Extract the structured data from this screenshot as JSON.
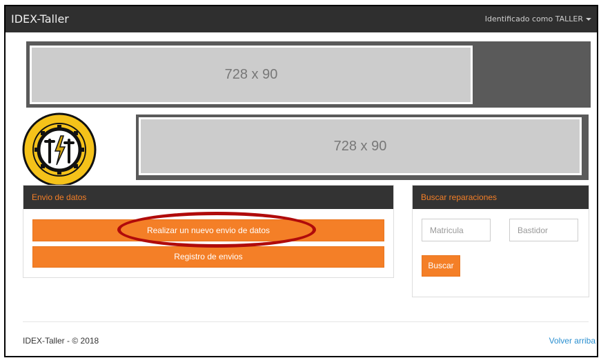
{
  "navbar": {
    "brand": "IDEX-Taller",
    "user_label": "Identificado como TALLER"
  },
  "banners": {
    "top_ad_label": "728 x 90",
    "second_ad_label": "728 x 90"
  },
  "logo": {
    "alt": "Gremi Provincial de Tallers de Reparació d'Automòbils Barcelona"
  },
  "envio_panel": {
    "title": "Envio de datos",
    "new_button_label": "Realizar un nuevo envio de datos",
    "registry_button_label": "Registro de envios"
  },
  "search_panel": {
    "title": "Buscar reparaciones",
    "matricula_placeholder": "Matricula",
    "bastidor_placeholder": "Bastidor",
    "search_button_label": "Buscar"
  },
  "footer": {
    "copyright": "IDEX-Taller - © 2018",
    "back_to_top": "Volver arriba"
  },
  "colors": {
    "navbar_bg": "#2f2f2f",
    "accent_orange": "#f47f27",
    "panel_heading_bg": "#333333",
    "highlight_red": "#b00b0b",
    "link_blue": "#2a8fd0"
  }
}
